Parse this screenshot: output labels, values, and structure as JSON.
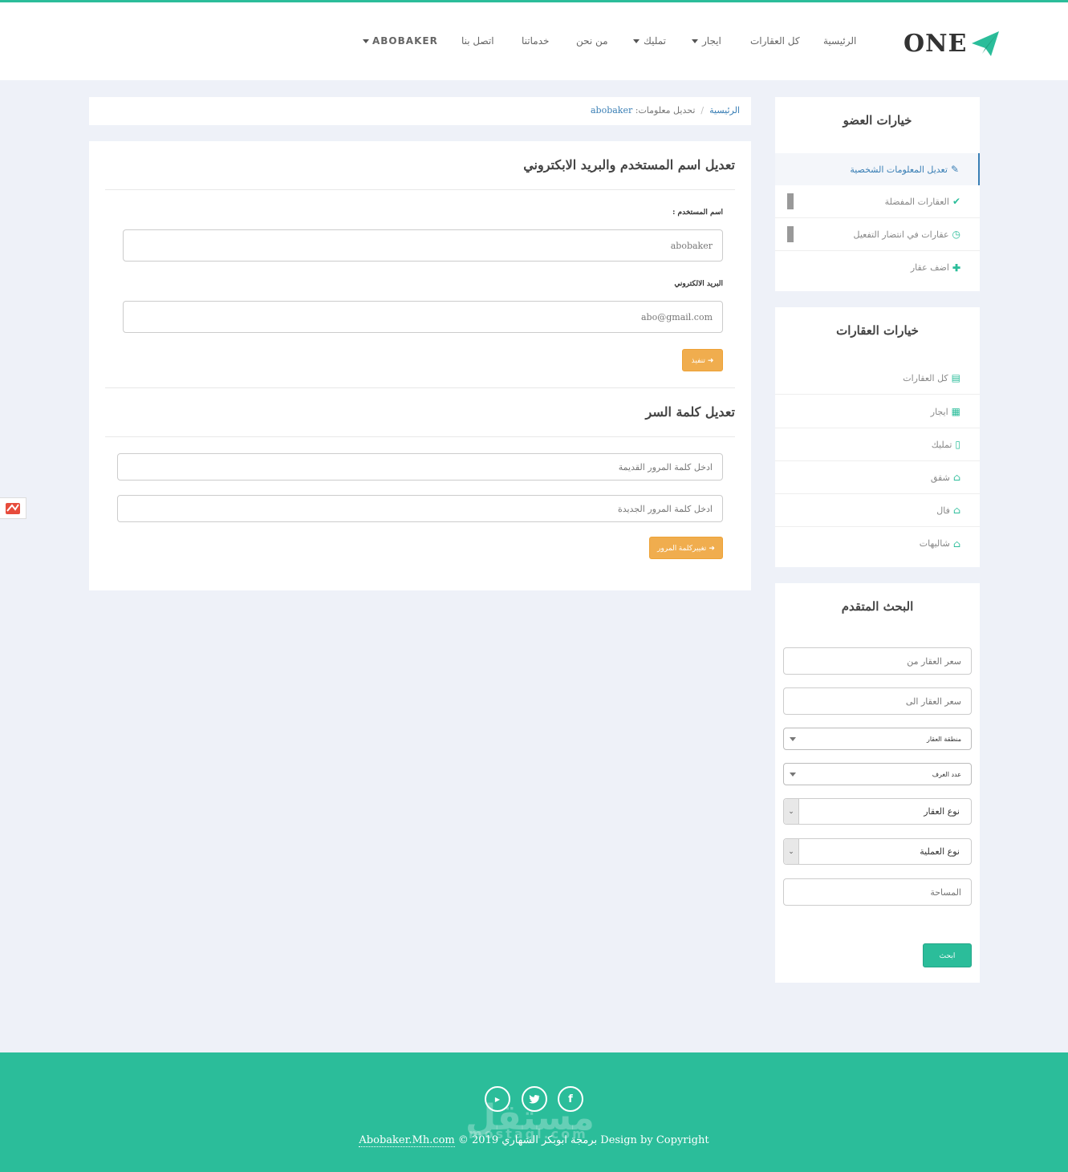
{
  "brand": {
    "logo_text": "ONE",
    "accent": "#2bbd9a",
    "link": "#3a7fb5",
    "warning": "#f0ad4e"
  },
  "nav": {
    "home": "الرئيسية",
    "all": "كل العقارات",
    "rent": "ايجار",
    "own": "تمليك",
    "about": "من نحن",
    "services": "خدماتنا",
    "contact": "اتصل بنا",
    "user": "ABOBAKER"
  },
  "breadcrumb": {
    "home": "الرئيسية",
    "current": "تحديل معلومات:",
    "username": "abobaker"
  },
  "profile_form": {
    "title": "تعديل اسم المستخدم والبريد الابكتروني",
    "username_label": "اسم المستخدم :",
    "username_value": "abobaker",
    "email_label": "البريد الالكتروني",
    "email_value": "abo@gmail.com",
    "submit_label": "تنفيذ"
  },
  "password_form": {
    "title": "تعديل كلمة السر",
    "old_placeholder": "ادخل كلمة المرور القديمة",
    "new_placeholder": "ادخل كلمة المرور الجديدة",
    "submit_label": "تغييركلمة المرور"
  },
  "member_options": {
    "title": "خيارات العضو",
    "items": [
      {
        "label": "تعديل المعلومات الشخصية",
        "icon": "edit-icon"
      },
      {
        "label": "العقارات المفضلة",
        "icon": "check-icon"
      },
      {
        "label": "عقارات في انتضار التفعيل",
        "icon": "clock-icon"
      },
      {
        "label": "اضف عقار",
        "icon": "plus-icon"
      }
    ]
  },
  "property_options": {
    "title": "خيارات العقارات",
    "items": [
      {
        "label": "كل العقارات",
        "icon": "list-icon"
      },
      {
        "label": "ايجار",
        "icon": "calendar-icon"
      },
      {
        "label": "تمليك",
        "icon": "building-icon"
      },
      {
        "label": "شقق",
        "icon": "bank-icon"
      },
      {
        "label": "فال",
        "icon": "home-icon"
      },
      {
        "label": "شاليهات",
        "icon": "bank-icon"
      }
    ]
  },
  "advanced_search": {
    "title": "البحث المتقدم",
    "price_from_placeholder": "سعر العقار من",
    "price_to_placeholder": "سعر العقار الى",
    "region": "منطقة العقار",
    "rooms": "عدد الغرف",
    "property_type": "نوع العقار",
    "operation_type": "نوع العملية",
    "area_placeholder": "المساحة",
    "submit_label": "ابحث"
  },
  "footer": {
    "copyright_link": "Abobaker.Mh.com",
    "copyright_text": "© 2019 برمجة ابوبكر الشهاري Design by Copyright",
    "watermark": "مستقل",
    "watermark_sub": "mostaql.com",
    "social": [
      "youtube-icon",
      "twitter-icon",
      "facebook-icon"
    ]
  }
}
